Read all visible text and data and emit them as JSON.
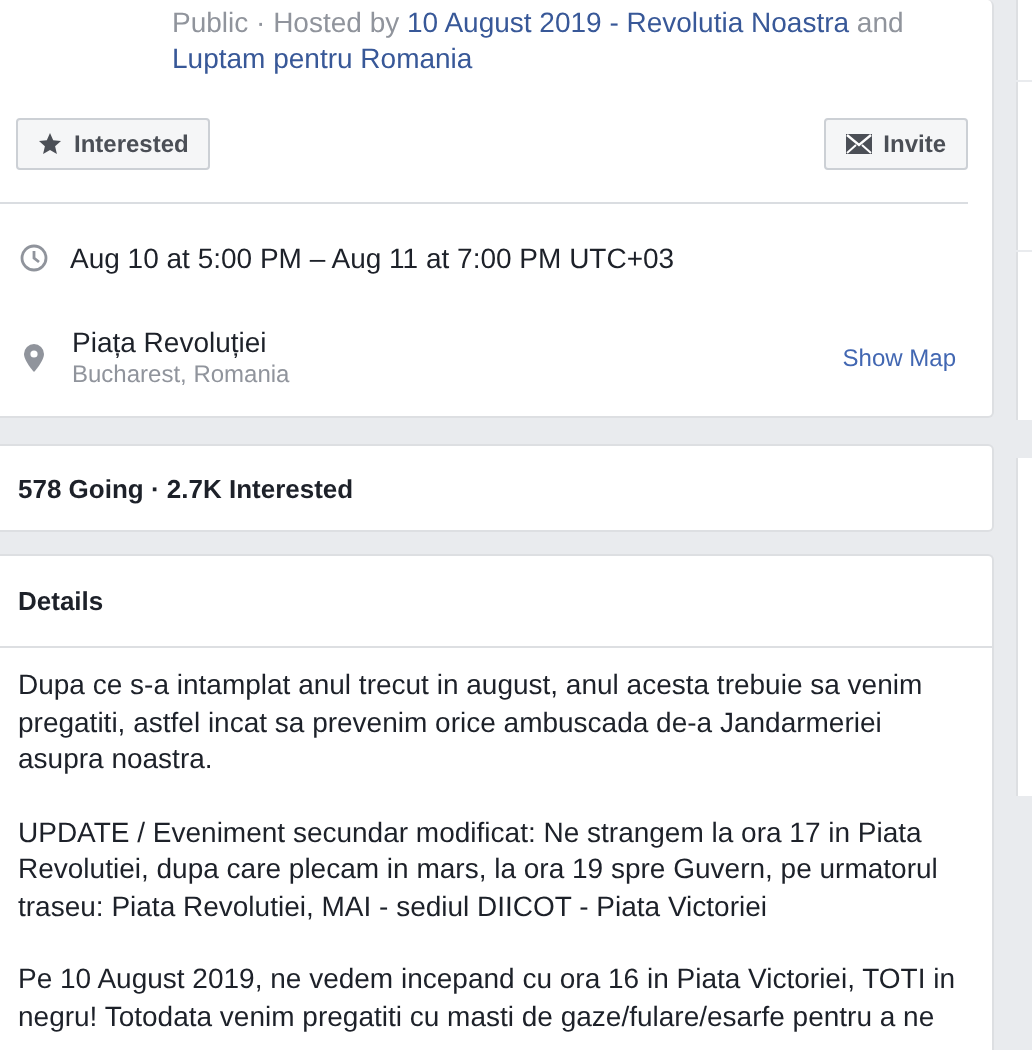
{
  "host_line": {
    "prefix": "Public · Hosted by",
    "hosts": [
      "10 August 2019 - Revolutia Noastra",
      "Luptam pentru Romania"
    ],
    "joiner": "and"
  },
  "actions": [
    {
      "label": "Interested",
      "kind": "star"
    },
    {
      "label": "Invite",
      "kind": "mail"
    }
  ],
  "when": {
    "text": "Aug 10 at 5:00 PM – Aug 11 at 7:00 PM UTC+03"
  },
  "where": {
    "place": "Piața Revoluției",
    "city": "Bucharest, Romania",
    "map_link": "Show Map"
  },
  "stats": "578 Going · 2.7K Interested",
  "details": {
    "title": "Details",
    "paragraphs": [
      "Dupa ce s-a intamplat anul trecut in august, anul acesta trebuie sa venim pregatiti, astfel incat sa prevenim orice ambuscada de-a Jandarmeriei asupra noastra.",
      "UPDATE / Eveniment secundar modificat: Ne strangem la ora 17 in Piata Revolutiei, dupa care plecam in mars, la ora 19 spre Guvern, pe urmatorul traseu: Piata Revolutiei, MAI - sediul DIICOT - Piata Victoriei",
      "Pe 10 August 2019, ne vedem incepand cu ora 16 in Piata Victoriei, TOTI in negru! Totodata venim pregatiti cu masti de gaze/fulare/esarfe pentru a ne"
    ]
  }
}
